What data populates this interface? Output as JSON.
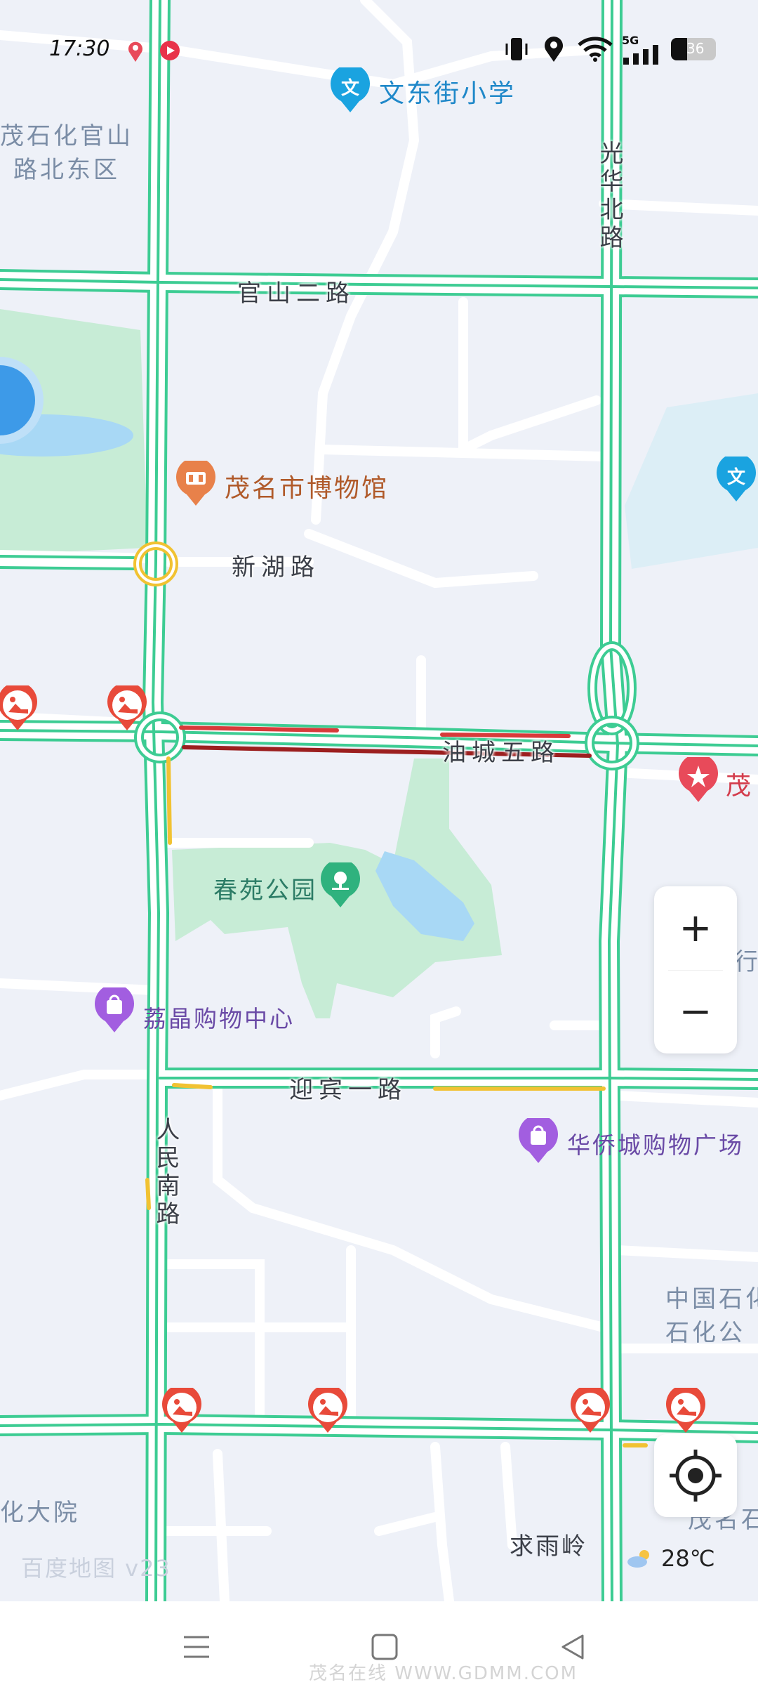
{
  "status_bar": {
    "time": "17:30",
    "network": "5G",
    "battery": "36",
    "icons": [
      "map-pin-notification-icon",
      "video-notification-icon",
      "vibrate-icon",
      "location-icon",
      "wifi-icon",
      "signal-icon",
      "battery-icon"
    ]
  },
  "map": {
    "roads": {
      "guanshan_2": "官山二路",
      "xinhu": "新湖路",
      "youcheng_5": "油城五路",
      "yingbin_1": "迎宾一路",
      "guanghua_north": "光华北路",
      "renmin_south": "人民南路"
    },
    "areas": {
      "top_left": "茂石化官山\n路北东区",
      "right_mid": "中国石化\n石化公",
      "right_bottom": "茂名石",
      "bottom_left": "化大院",
      "right_clip": "行农"
    },
    "pois": {
      "school_top": "文东街小学",
      "museum": "茂名市博物馆",
      "park": "春苑公园",
      "mall_left": "荔晶购物中心",
      "mall_right": "华侨城购物广场",
      "hill": "求雨岭",
      "red_poi_right": "茂"
    },
    "watermark": "百度地图 v23",
    "colors": {
      "background": "#eef1f8",
      "road_edge": "#3dcc93",
      "road_fill": "#ffffff",
      "congestion_red": "#d83a3a",
      "congestion_darkred": "#9c1f1f",
      "slow_yellow": "#f1c232",
      "park_green": "#c7ecd6",
      "water_blue": "#a8d8f5"
    }
  },
  "controls": {
    "zoom_in": "+",
    "zoom_out": "−",
    "locate_icon": "locate-crosshair-icon"
  },
  "weather": {
    "icon": "partly-cloudy-icon",
    "temperature": "28℃"
  },
  "nav_bar": {
    "icons": [
      "menu-icon",
      "home-square-icon",
      "back-triangle-icon"
    ]
  },
  "site_watermark": "茂名在线 WWW.GDMM.COM"
}
